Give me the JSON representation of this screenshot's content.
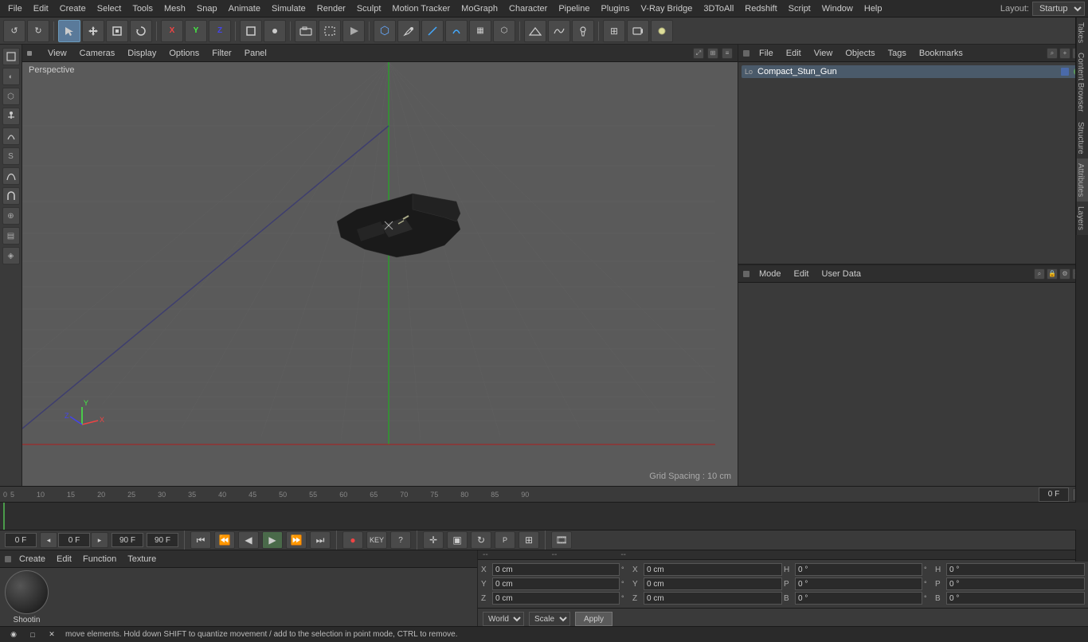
{
  "app": {
    "title": "Cinema 4D"
  },
  "menubar": {
    "items": [
      "File",
      "Edit",
      "Create",
      "Select",
      "Tools",
      "Mesh",
      "Snap",
      "Animate",
      "Simulate",
      "Render",
      "Sculpt",
      "Motion Tracker",
      "MoGraph",
      "Character",
      "Pipeline",
      "Plugins",
      "V-Ray Bridge",
      "3DToAll",
      "Redshift",
      "Script",
      "Window",
      "Help"
    ],
    "layout_label": "Layout:",
    "layout_value": "Startup"
  },
  "viewport": {
    "menus": [
      "View",
      "Cameras",
      "Display",
      "Options",
      "Filter",
      "Panel"
    ],
    "label": "Perspective",
    "grid_spacing": "Grid Spacing : 10 cm"
  },
  "toolbar": {
    "undo_label": "↺",
    "redo_label": "↻"
  },
  "objects_panel": {
    "menus": [
      "File",
      "Edit",
      "View",
      "Objects",
      "Tags",
      "Bookmarks"
    ],
    "object_name": "Compact_Stun_Gun"
  },
  "attributes_panel": {
    "menus": [
      "Mode",
      "Edit",
      "User Data"
    ]
  },
  "material_editor": {
    "menus": [
      "Create",
      "Edit",
      "Function",
      "Texture"
    ],
    "material_name": "Shootin"
  },
  "timeline": {
    "markers": [
      "0",
      "5",
      "10",
      "15",
      "20",
      "25",
      "30",
      "35",
      "40",
      "45",
      "50",
      "55",
      "60",
      "65",
      "70",
      "75",
      "80",
      "85",
      "90"
    ],
    "current_frame": "0 F",
    "start_frame": "0 F",
    "end_frame": "90 F",
    "preview_end": "90 F"
  },
  "transport": {
    "go_start": "⏮",
    "step_back": "⏪",
    "play_back": "◀",
    "play_fwd": "▶",
    "step_fwd": "⏩",
    "go_end": "⏭"
  },
  "coords": {
    "x_pos": "0 cm",
    "y_pos": "0 cm",
    "z_pos": "0 cm",
    "x_rot": "",
    "y_rot": "",
    "z_rot": "",
    "h_label": "H",
    "p_label": "P",
    "b_label": "B",
    "h_val": "0 °",
    "p_val": "0 °",
    "b_val": "0 °",
    "x_size": "0 cm",
    "y_size": "0 cm",
    "z_size": "0 cm"
  },
  "world_apply": {
    "world_label": "World",
    "scale_label": "Scale",
    "apply_label": "Apply"
  },
  "status": {
    "message": "move elements. Hold down SHIFT to quantize movement / add to the selection in point mode, CTRL to remove."
  },
  "right_tabs": {
    "takes": "Takes",
    "content_browser": "Content Browser",
    "structure": "Structure",
    "attributes": "Attributes",
    "layers": "Layers"
  }
}
